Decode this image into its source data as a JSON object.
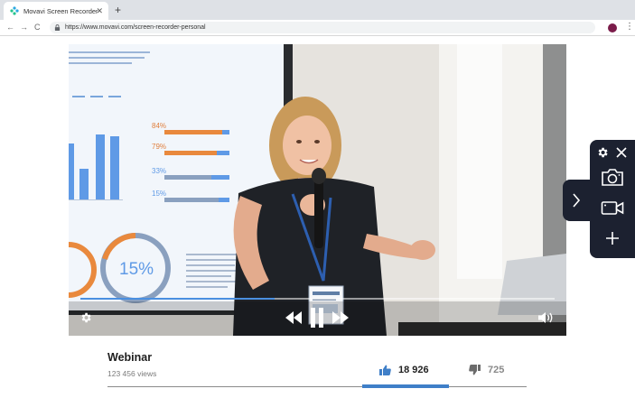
{
  "browser": {
    "tab_title": "Movavi Screen Recorder",
    "tab_close": "✕",
    "new_tab": "+",
    "back": "←",
    "forward": "→",
    "reload": "C",
    "url": "https://www.movavi.com/screen-recorder-personal",
    "menu": "⋮"
  },
  "video": {
    "progress_fraction": 0.41,
    "slide_percent_label": "15%",
    "slide_bar_labels": [
      "84%",
      "79%",
      "33%",
      "15%"
    ]
  },
  "video_info": {
    "title": "Webinar",
    "views": "123 456 views",
    "likes": "18 926",
    "dislikes": "725"
  },
  "colors": {
    "accent": "#3f7fc8",
    "recorder_bg": "#1c2130"
  },
  "icons": {
    "recorder": [
      "gear-icon",
      "close-icon",
      "camera-icon",
      "video-camera-icon",
      "plus-icon",
      "chevron-right-icon"
    ],
    "player": [
      "gear-icon",
      "rewind-icon",
      "pause-icon",
      "fast-forward-icon",
      "volume-icon"
    ],
    "rating": [
      "thumbs-up-icon",
      "thumbs-down-icon"
    ]
  }
}
